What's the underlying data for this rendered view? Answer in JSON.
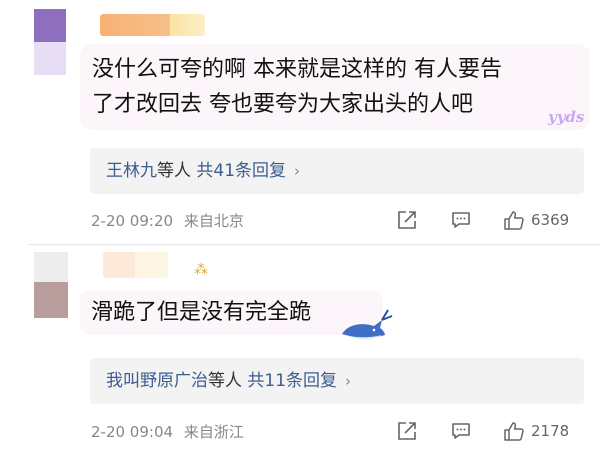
{
  "comments": [
    {
      "text_line1": "没什么可夸的啊 本来就是这样的 有人要告",
      "text_line2": "了才改回去 夸也要夸为大家出头的人吧",
      "sticker_text": "yyds",
      "reply_summary": {
        "names": "王林九",
        "etc": "等人",
        "count": "共41条回复",
        "chevron": "›"
      },
      "timestamp": "2-20 09:20",
      "location": "来自北京",
      "likes": "6369",
      "avatar_colors": [
        "#8d6fbd",
        "#e7def5"
      ]
    },
    {
      "text": "滑跪了但是没有完全跪",
      "badge": "⁂",
      "reply_summary": {
        "names": "我叫野原广治",
        "etc": "等人",
        "count": "共11条回复",
        "chevron": "›"
      },
      "timestamp": "2-20 09:04",
      "location": "来自浙江",
      "likes": "2178",
      "avatar_colors": [
        "#ededed",
        "#b99d9d"
      ]
    }
  ],
  "icons": [
    "share-icon",
    "comment-icon",
    "like-icon",
    "whale-sticker-icon"
  ],
  "colors": {
    "link": "#3c5d8f",
    "meta": "#888888",
    "reply_bg": "#f3f3f3",
    "bubble_bg": "#fcf6fb"
  }
}
